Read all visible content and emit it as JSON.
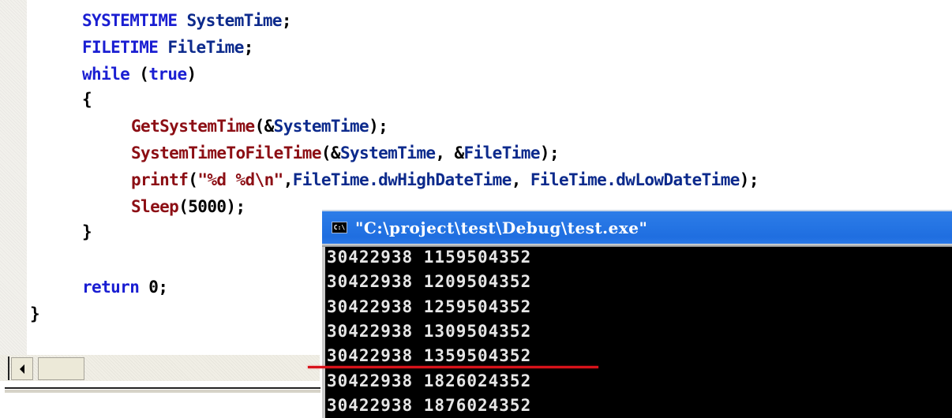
{
  "editor": {
    "lines": [
      {
        "indent": 1,
        "tokens": [
          {
            "t": "SYSTEMTIME",
            "c": "ty"
          },
          {
            "t": " SystemTime",
            "c": "var"
          },
          {
            "t": ";",
            "c": "punc"
          }
        ]
      },
      {
        "indent": 1,
        "tokens": [
          {
            "t": "FILETIME",
            "c": "ty"
          },
          {
            "t": " FileTime",
            "c": "var"
          },
          {
            "t": ";",
            "c": "punc"
          }
        ]
      },
      {
        "indent": 1,
        "tokens": [
          {
            "t": "while",
            "c": "kw"
          },
          {
            "t": " (",
            "c": "punc"
          },
          {
            "t": "true",
            "c": "kw"
          },
          {
            "t": ")",
            "c": "punc"
          }
        ]
      },
      {
        "indent": 1,
        "tokens": [
          {
            "t": "{",
            "c": "punc"
          }
        ]
      },
      {
        "indent": 2,
        "tokens": [
          {
            "t": "GetSystemTime",
            "c": "fn"
          },
          {
            "t": "(&",
            "c": "punc"
          },
          {
            "t": "SystemTime",
            "c": "var"
          },
          {
            "t": ");",
            "c": "punc"
          }
        ]
      },
      {
        "indent": 2,
        "tokens": [
          {
            "t": "SystemTimeToFileTime",
            "c": "fn"
          },
          {
            "t": "(&",
            "c": "punc"
          },
          {
            "t": "SystemTime",
            "c": "var"
          },
          {
            "t": ", &",
            "c": "punc"
          },
          {
            "t": "FileTime",
            "c": "var"
          },
          {
            "t": ");",
            "c": "punc"
          }
        ]
      },
      {
        "indent": 2,
        "tokens": [
          {
            "t": "printf",
            "c": "fn"
          },
          {
            "t": "(",
            "c": "punc"
          },
          {
            "t": "\"%d %d\\n\"",
            "c": "str"
          },
          {
            "t": ",",
            "c": "punc"
          },
          {
            "t": "FileTime.dwHighDateTime",
            "c": "var"
          },
          {
            "t": ", ",
            "c": "punc"
          },
          {
            "t": "FileTime.dwLowDateTime",
            "c": "var"
          },
          {
            "t": ");",
            "c": "punc"
          }
        ]
      },
      {
        "indent": 2,
        "tokens": [
          {
            "t": "Sleep",
            "c": "fn"
          },
          {
            "t": "(5000);",
            "c": "punc"
          }
        ]
      },
      {
        "indent": 1,
        "tokens": [
          {
            "t": "}",
            "c": "punc"
          }
        ]
      },
      {
        "indent": 1,
        "tokens": []
      },
      {
        "indent": 1,
        "tokens": [
          {
            "t": "return",
            "c": "kw"
          },
          {
            "t": " 0;",
            "c": "punc"
          }
        ]
      },
      {
        "indent": 0,
        "tokens": [
          {
            "t": "}",
            "c": "punc"
          }
        ]
      }
    ]
  },
  "console": {
    "icon_label": "C:\\",
    "title": "\"C:\\project\\test\\Debug\\test.exe\"",
    "output_lines": [
      "30422938 1159504352",
      "30422938 1209504352",
      "30422938 1259504352",
      "30422938 1309504352",
      "30422938 1359504352",
      "30422938 1826024352",
      "30422938 1876024352"
    ]
  },
  "colors": {
    "keyword": "#1a1ed2",
    "function": "#8c0e14",
    "variable": "#0c2a8c",
    "console_title_bar": "#1f6ee0",
    "marker": "#d8121a"
  }
}
